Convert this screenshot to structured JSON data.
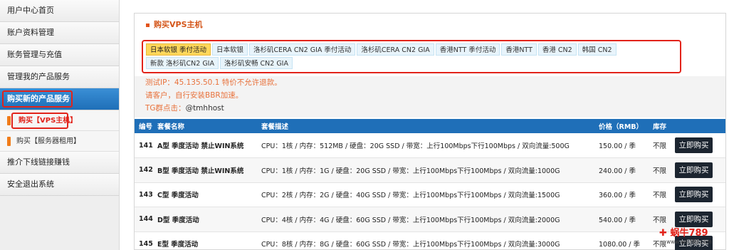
{
  "sidebar": {
    "items": [
      {
        "label": "用户中心首页"
      },
      {
        "label": "账户资料管理"
      },
      {
        "label": "账务管理与充值"
      },
      {
        "label": "管理我的产品服务"
      },
      {
        "label": "购买新的产品服务"
      }
    ],
    "sub_items": [
      {
        "label": "购买【VPS主机】"
      },
      {
        "label": "购买【服务器租用】"
      }
    ],
    "bottom_items": [
      {
        "label": "推介下线链接赚钱"
      },
      {
        "label": "安全退出系统"
      }
    ]
  },
  "panel": {
    "title": "购买VPS主机"
  },
  "tabs": [
    {
      "label": "日本软银 季付活动"
    },
    {
      "label": "日本软银"
    },
    {
      "label": "洛杉矶CERA CN2 GIA 季付活动"
    },
    {
      "label": "洛杉矶CERA CN2 GIA"
    },
    {
      "label": "香港NTT 季付活动"
    },
    {
      "label": "香港NTT"
    },
    {
      "label": "香港 CN2"
    },
    {
      "label": "韩国 CN2"
    },
    {
      "label": "新款 洛杉矶CN2 GIA"
    },
    {
      "label": "洛杉矶安畅 CN2 GIA"
    }
  ],
  "notes": {
    "test_ip": "测试IP：45.135.50.1 特价不允许退款。",
    "bbr": "请客户，自行安装BBR加速。",
    "tg_label": "TG群点击：",
    "tg_handle": "@tmhhost"
  },
  "table": {
    "headers": {
      "id": "编号",
      "name": "套餐名称",
      "desc": "套餐描述",
      "price": "价格（RMB）",
      "stock": "库存"
    },
    "buy_label": "立即购买",
    "rows": [
      {
        "id": "141",
        "name": "A型 季度活动 禁止WIN系统",
        "desc": "CPU：1核 / 内存：512MB / 硬盘：20G SSD / 带宽：上行100Mbps下行100Mbps / 双向流量:500G",
        "price": "150.00 / 季",
        "stock": "不限"
      },
      {
        "id": "142",
        "name": "B型 季度活动 禁止WIN系统",
        "desc": "CPU：1核 / 内存：1G / 硬盘：20G SSD / 带宽：上行100Mbps下行100Mbps / 双向流量:1000G",
        "price": "240.00 / 季",
        "stock": "不限"
      },
      {
        "id": "143",
        "name": "C型 季度活动",
        "desc": "CPU：2核 / 内存：2G / 硬盘：40G SSD / 带宽：上行100Mbps下行100Mbps / 双向流量:1500G",
        "price": "360.00 / 季",
        "stock": "不限"
      },
      {
        "id": "144",
        "name": "D型 季度活动",
        "desc": "CPU：4核 / 内存：4G / 硬盘：60G SSD / 带宽：上行100Mbps下行100Mbps / 双向流量:2000G",
        "price": "540.00 / 季",
        "stock": "不限"
      },
      {
        "id": "145",
        "name": "E型 季度活动",
        "desc": "CPU：8核 / 内存：8G / 硬盘：60G SSD / 带宽：上行100Mbps下行100Mbps / 双向流量:3000G",
        "price": "1080.00 / 季",
        "stock": "不限"
      }
    ]
  },
  "watermark": {
    "name": "蜗牛789",
    "url": "www.wn789.com"
  },
  "colors": {
    "accent_blue": "#1f6fb8",
    "highlight_red": "#e2231a",
    "note_orange": "#e8723c"
  }
}
